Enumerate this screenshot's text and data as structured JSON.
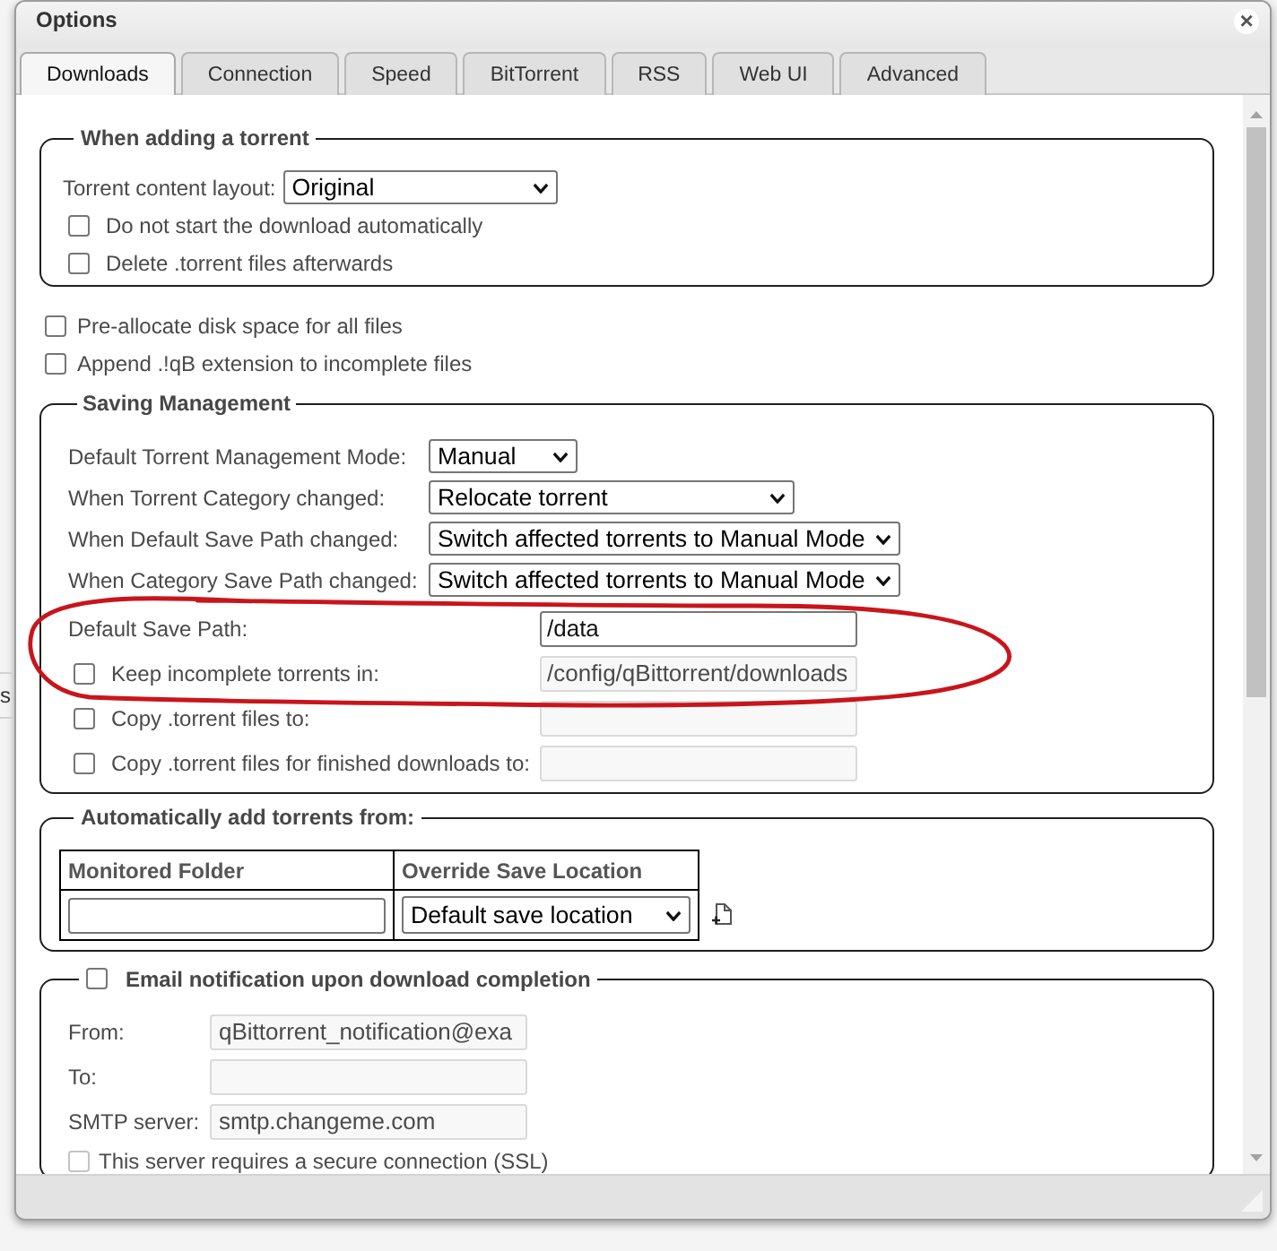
{
  "window": {
    "title": "Options",
    "close": "×"
  },
  "tabs": [
    {
      "label": "Downloads",
      "selected": true
    },
    {
      "label": "Connection",
      "selected": false
    },
    {
      "label": "Speed",
      "selected": false
    },
    {
      "label": "BitTorrent",
      "selected": false
    },
    {
      "label": "RSS",
      "selected": false
    },
    {
      "label": "Web UI",
      "selected": false
    },
    {
      "label": "Advanced",
      "selected": false
    }
  ],
  "adding_torrent": {
    "legend": "When adding a torrent",
    "content_layout": {
      "label": "Torrent content layout:",
      "value": "Original"
    },
    "options": [
      {
        "label": "Do not start the download automatically",
        "checked": false
      },
      {
        "label": "Delete .torrent files afterwards",
        "checked": false
      }
    ]
  },
  "disk_options": [
    {
      "label": "Pre-allocate disk space for all files",
      "checked": false
    },
    {
      "label": "Append .!qB extension to incomplete files",
      "checked": false
    }
  ],
  "saving_management": {
    "legend": "Saving Management",
    "modes": [
      {
        "label": "Default Torrent Management Mode:",
        "value": "Manual"
      },
      {
        "label": "When Torrent Category changed:",
        "value": "Relocate torrent"
      },
      {
        "label": "When Default Save Path changed:",
        "value": "Switch affected torrents to Manual Mode"
      },
      {
        "label": "When Category Save Path changed:",
        "value": "Switch affected torrents to Manual Mode"
      }
    ],
    "paths": [
      {
        "kind": "plain",
        "label": "Default Save Path:",
        "value": "/data",
        "disabled": false
      },
      {
        "kind": "checkbox",
        "label": "Keep incomplete torrents in:",
        "checked": false,
        "value": "/config/qBittorrent/downloads",
        "disabled": true
      },
      {
        "kind": "checkbox",
        "label": "Copy .torrent files to:",
        "checked": false,
        "disabled": true
      },
      {
        "kind": "checkbox",
        "label": "Copy .torrent files for finished downloads to:",
        "checked": false,
        "disabled": true
      }
    ]
  },
  "auto_add": {
    "legend": "Automatically add torrents from:",
    "columns": [
      "Monitored Folder",
      "Override Save Location"
    ],
    "rows": [
      {
        "location": "Default save location"
      }
    ]
  },
  "email": {
    "legend": "Email notification upon download completion",
    "checked": false,
    "fields": [
      {
        "label": "From:",
        "value": "qBittorrent_notification@exa",
        "disabled": true
      },
      {
        "label": "To:",
        "disabled": true
      },
      {
        "label": "SMTP server:",
        "value": "smtp.changeme.com",
        "disabled": true
      }
    ],
    "ssl": {
      "label": "This server requires a secure connection (SSL)",
      "checked": false,
      "disabled": true
    }
  },
  "annotation": {
    "kind": "loop"
  },
  "background_page": {
    "text": "s"
  }
}
